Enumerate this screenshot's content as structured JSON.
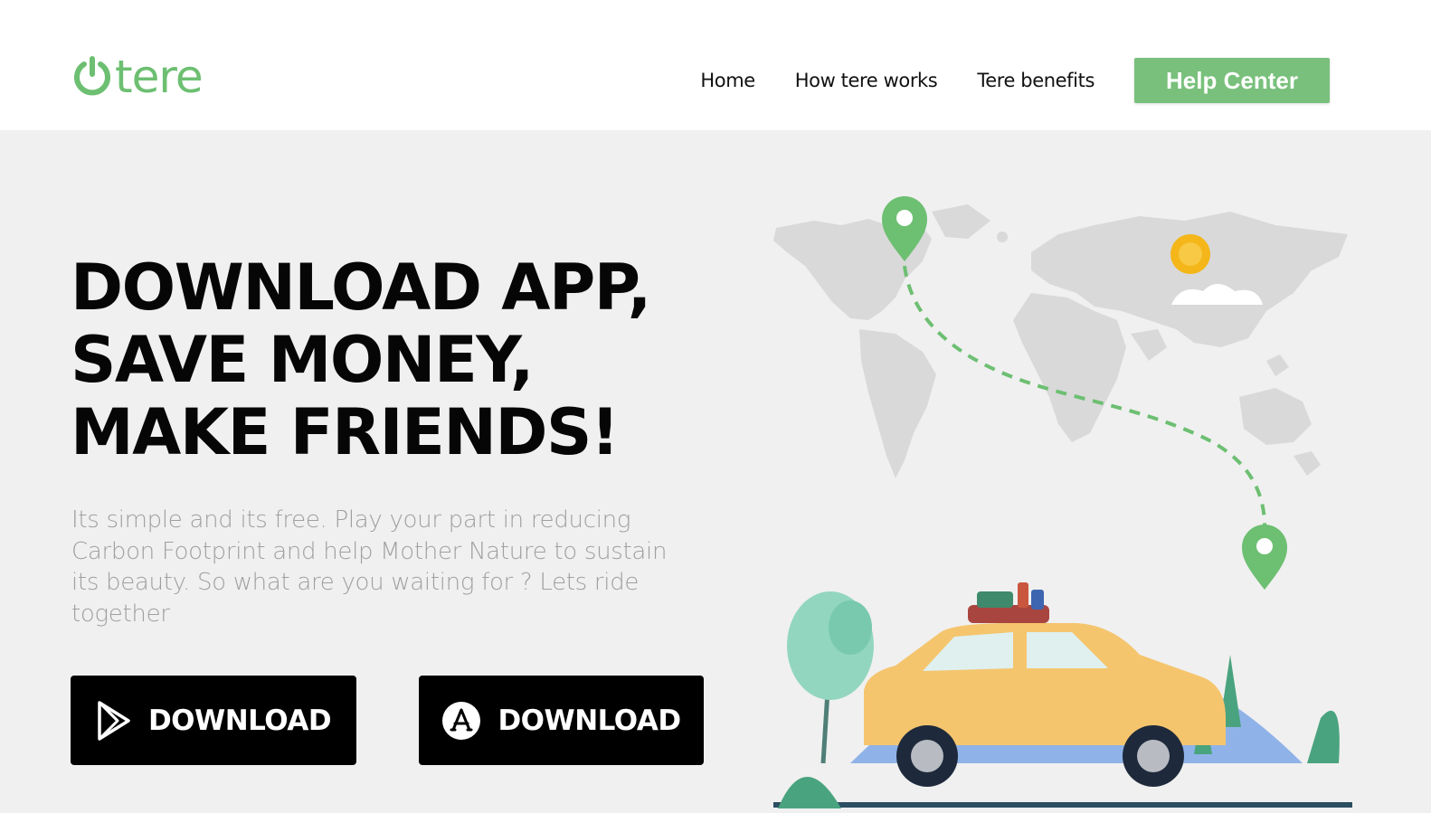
{
  "logo": {
    "text": "tere",
    "icon": "power-icon",
    "color": "#6dbf72"
  },
  "nav": {
    "items": [
      {
        "label": "Home"
      },
      {
        "label": "How tere works"
      },
      {
        "label": "Tere benefits"
      }
    ],
    "help_center_label": "Help Center"
  },
  "hero": {
    "headline": [
      "DOWNLOAD APP,",
      "SAVE MONEY,",
      "MAKE FRIENDS!"
    ],
    "description": "Its simple and its free. Play your part in reducing Carbon Footprint and help Mother Nature to sustain its beauty. So what are you waiting for ? Lets ride together",
    "buttons": [
      {
        "label": "DOWNLOAD",
        "icon": "google-play-icon"
      },
      {
        "label": "DOWNLOAD",
        "icon": "app-store-icon"
      }
    ]
  },
  "illustration": {
    "name": "world-map-road-trip-illustration"
  },
  "colors": {
    "brand_green": "#6dbf72",
    "button_green": "#78c07b",
    "hero_background": "#f0f0f0",
    "headline": "#060606",
    "description": "#a0a0a0"
  }
}
